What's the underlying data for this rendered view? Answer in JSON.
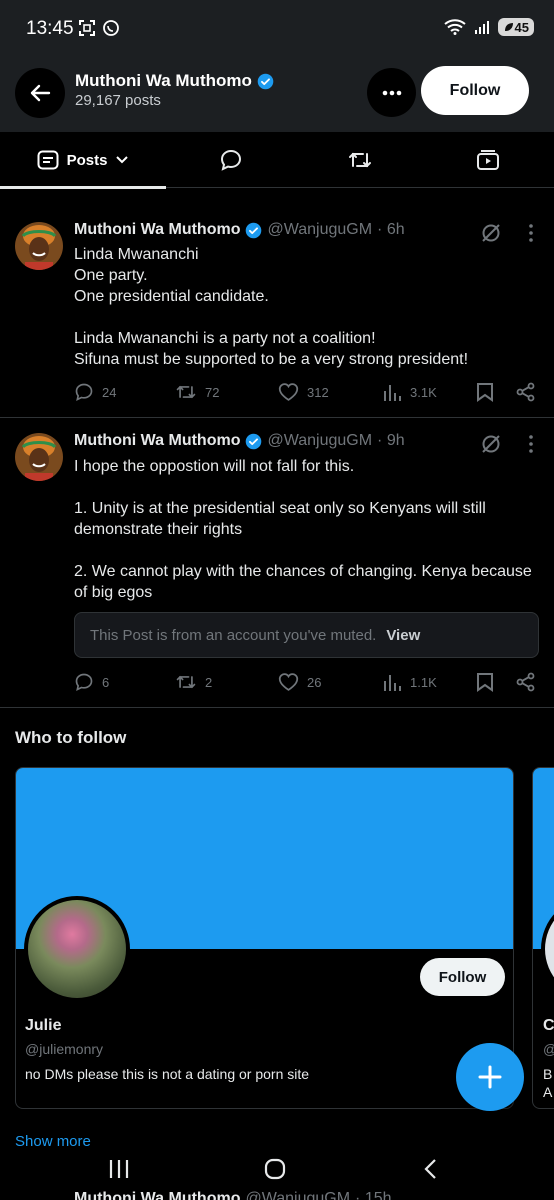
{
  "status_bar": {
    "time": "13:45",
    "battery": "45"
  },
  "header": {
    "name": "Muthoni Wa Muthomo",
    "posts_count": "29,167 posts",
    "follow_label": "Follow"
  },
  "tabs": {
    "posts_label": "Posts"
  },
  "posts": [
    {
      "name": "Muthoni Wa Muthomo",
      "handle": "@WanjuguGM",
      "time": "· 6h",
      "body": "Linda Mwananchi\nOne party.\nOne presidential candidate.\n\nLinda Mwananchi is a party not a coalition!\nSifuna must be supported to be a very strong president!",
      "replies": "24",
      "reposts": "72",
      "likes": "312",
      "views": "3.1K"
    },
    {
      "name": "Muthoni Wa Muthomo",
      "handle": "@WanjuguGM",
      "time": "· 9h",
      "body": "I hope the oppostion will not fall for this.\n\n1. Unity is at the presidential seat only so Kenyans will still demonstrate their rights\n\n2. We cannot play with the chances of changing. Kenya because of big egos",
      "muted_text": "This Post is from an account you've muted.",
      "muted_view": "View",
      "replies": "6",
      "reposts": "2",
      "likes": "26",
      "views": "1.1K"
    }
  ],
  "who_to_follow": {
    "title": "Who to follow",
    "card": {
      "name": "Julie",
      "handle": "@juliemonry",
      "bio": "no DMs please this is not a dating or porn site",
      "follow_label": "Follow"
    },
    "card2": {
      "name_initial": "C",
      "handle_initial": "@",
      "bio_line1": "B",
      "bio_line2": "A"
    },
    "show_more": "Show more"
  },
  "peek_post": {
    "name": "Muthoni Wa Muthomo",
    "handle": "@WanjuguGM",
    "time": "· 15h"
  },
  "colors": {
    "accent": "#1d9bf0",
    "background": "#000000",
    "muted_text": "#71767b"
  }
}
